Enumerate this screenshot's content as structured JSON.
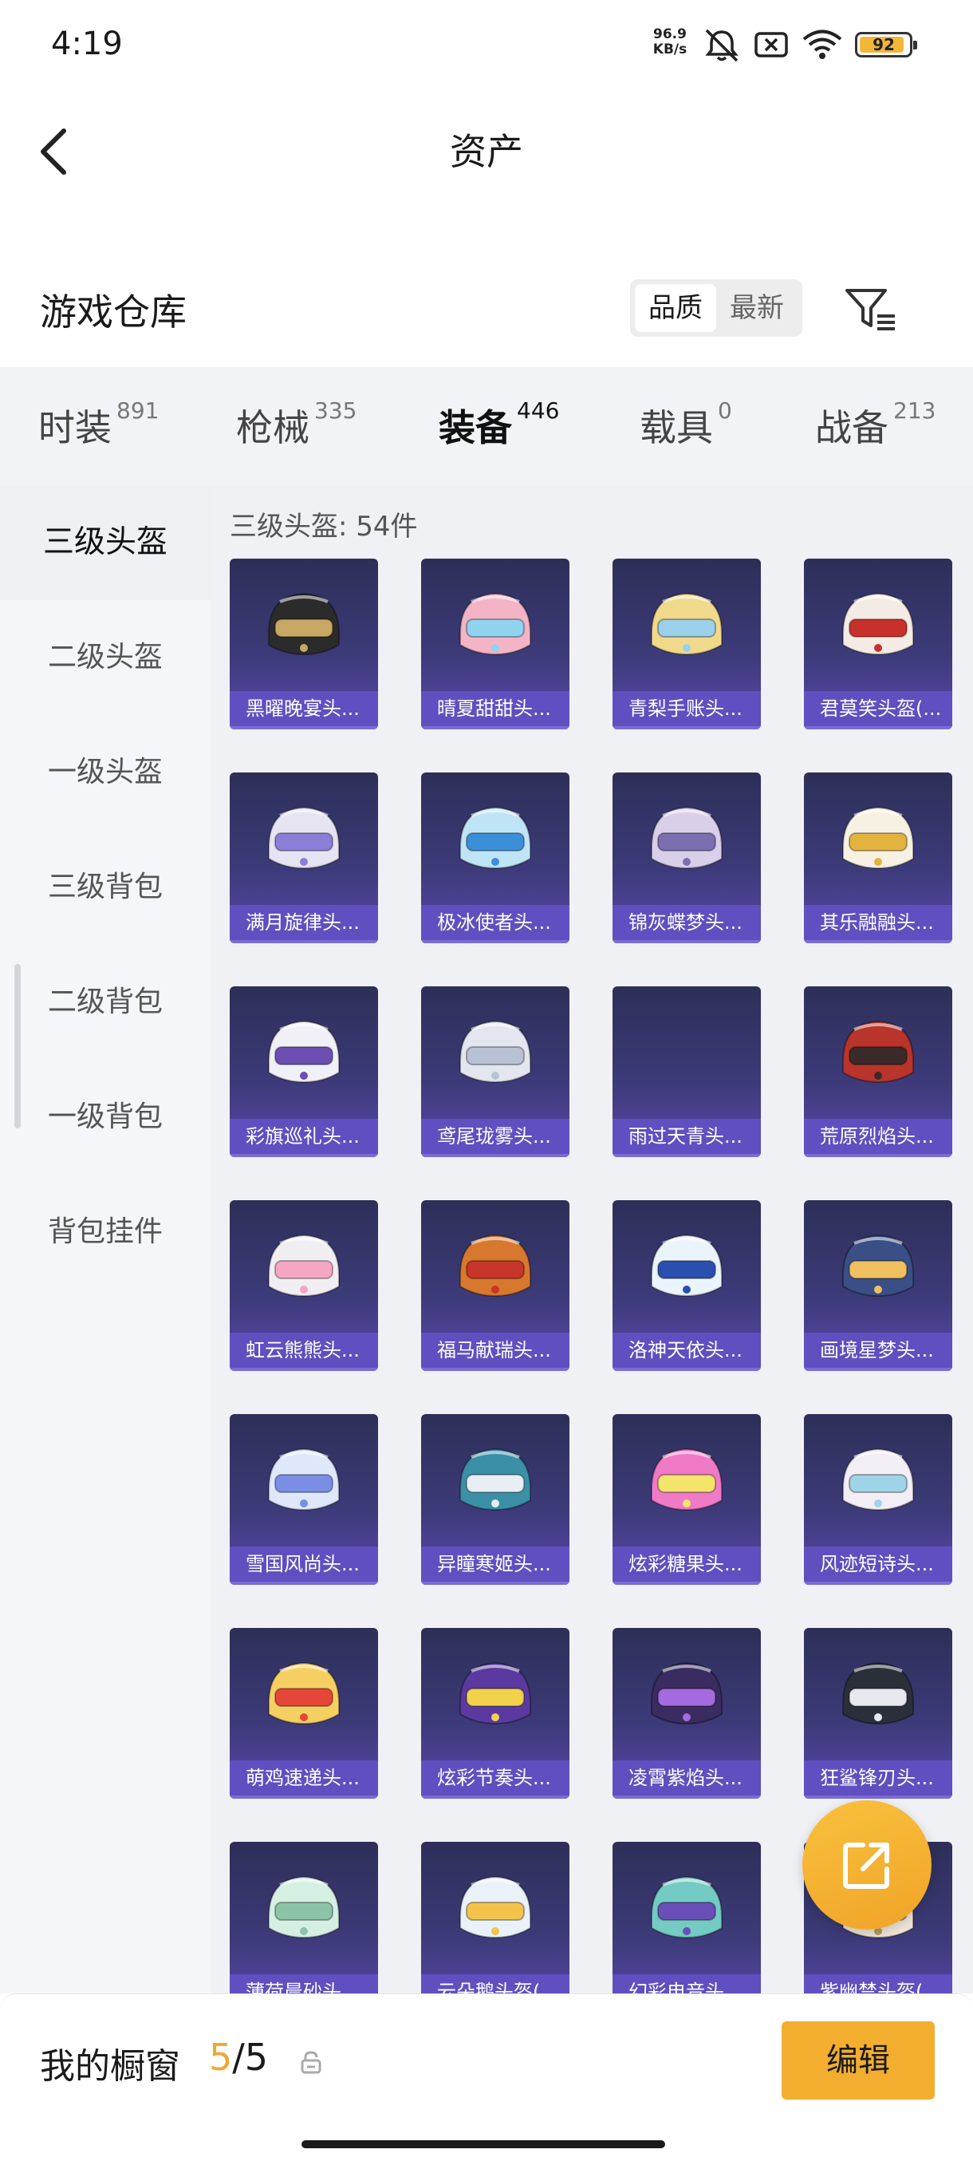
{
  "status_bar": {
    "time": "4:19",
    "net_speed": "96.9",
    "net_unit": "KB/s",
    "battery": "92",
    "battery_level": 0.92
  },
  "header": {
    "title": "资产"
  },
  "warehouse": {
    "title": "游戏仓库",
    "sort_options": [
      "品质",
      "最新"
    ],
    "active_sort": "品质"
  },
  "tabs": [
    {
      "label": "时装",
      "count": "891"
    },
    {
      "label": "枪械",
      "count": "335"
    },
    {
      "label": "装备",
      "count": "446",
      "active": true
    },
    {
      "label": "载具",
      "count": "0"
    },
    {
      "label": "战备",
      "count": "213"
    }
  ],
  "sidebar": {
    "items": [
      {
        "label": "三级头盔",
        "active": true
      },
      {
        "label": "二级头盔"
      },
      {
        "label": "一级头盔"
      },
      {
        "label": "三级背包"
      },
      {
        "label": "二级背包"
      },
      {
        "label": "一级背包"
      },
      {
        "label": "背包挂件"
      }
    ]
  },
  "grid": {
    "category_title": "三级头盔: 54件",
    "items": [
      {
        "name": "黑曜晚宴头...",
        "color": "#2b2b2b",
        "accent": "#c9a865"
      },
      {
        "name": "晴夏甜甜头...",
        "color": "#f3b4c6",
        "accent": "#8fd3ee"
      },
      {
        "name": "青梨手账头...",
        "color": "#f0d98a",
        "accent": "#9ad0ea"
      },
      {
        "name": "君莫笑头盔(...",
        "color": "#f4ece4",
        "accent": "#c8302c"
      },
      {
        "name": "满月旋律头...",
        "color": "#e6e3f2",
        "accent": "#8a7fd6"
      },
      {
        "name": "极冰使者头...",
        "color": "#bfe4f6",
        "accent": "#3a8fd8"
      },
      {
        "name": "锦灰蝶梦头...",
        "color": "#d9cfe9",
        "accent": "#7c6fb0"
      },
      {
        "name": "其乐融融头...",
        "color": "#f7f1e3",
        "accent": "#e3b340"
      },
      {
        "name": "彩旗巡礼头...",
        "color": "#f2f0f7",
        "accent": "#6b4fb2"
      },
      {
        "name": "鸢尾珑雾头...",
        "color": "#e3e6ee",
        "accent": "#b9c2d4"
      },
      {
        "name": "雨过天青头...",
        "color": "",
        "accent": ""
      },
      {
        "name": "荒原烈焰头...",
        "color": "#b9342a",
        "accent": "#3a2a2a"
      },
      {
        "name": "虹云熊熊头...",
        "color": "#f1eef2",
        "accent": "#f4a6c2"
      },
      {
        "name": "福马献瑞头...",
        "color": "#d8782e",
        "accent": "#c8352a"
      },
      {
        "name": "洛神天依头...",
        "color": "#eaf4fb",
        "accent": "#2b4fae"
      },
      {
        "name": "画境星梦头...",
        "color": "#3a4f86",
        "accent": "#f0c060"
      },
      {
        "name": "雪国风尚头...",
        "color": "#dfe8fb",
        "accent": "#7a8ee6"
      },
      {
        "name": "异瞳寒姬头...",
        "color": "#3b8fa6",
        "accent": "#e9eef5"
      },
      {
        "name": "炫彩糖果头...",
        "color": "#f07ac6",
        "accent": "#f3e46a"
      },
      {
        "name": "风迹短诗头...",
        "color": "#f3eef5",
        "accent": "#9fd3e8"
      },
      {
        "name": "萌鸡速递头...",
        "color": "#f6cf63",
        "accent": "#e6463a"
      },
      {
        "name": "炫彩节奏头...",
        "color": "#5a3aa0",
        "accent": "#f2d24a"
      },
      {
        "name": "凌霄紫焰头...",
        "color": "#3a2c60",
        "accent": "#a46be0"
      },
      {
        "name": "狂鲨锋刃头...",
        "color": "#2a2f3a",
        "accent": "#e7e9ef"
      },
      {
        "name": "薄荷晨砂头...",
        "color": "#d6efe3",
        "accent": "#8cc4a8"
      },
      {
        "name": "云朵鹅头盔(...",
        "color": "#e8f2f8",
        "accent": "#f3c34b"
      },
      {
        "name": "幻彩电音头...",
        "color": "#73cbc4",
        "accent": "#6a4fb8"
      },
      {
        "name": "紫幽禁头盔(...",
        "color": "#efe6d8",
        "accent": "#b89a5c"
      }
    ]
  },
  "bottom_bar": {
    "label": "我的橱窗",
    "current": "5",
    "separator": "/",
    "total": "5",
    "edit_label": "编辑"
  },
  "colors": {
    "accent": "#f3ae2f",
    "card_top": "#2d2f58",
    "card_caption": "#5f4fc0"
  }
}
